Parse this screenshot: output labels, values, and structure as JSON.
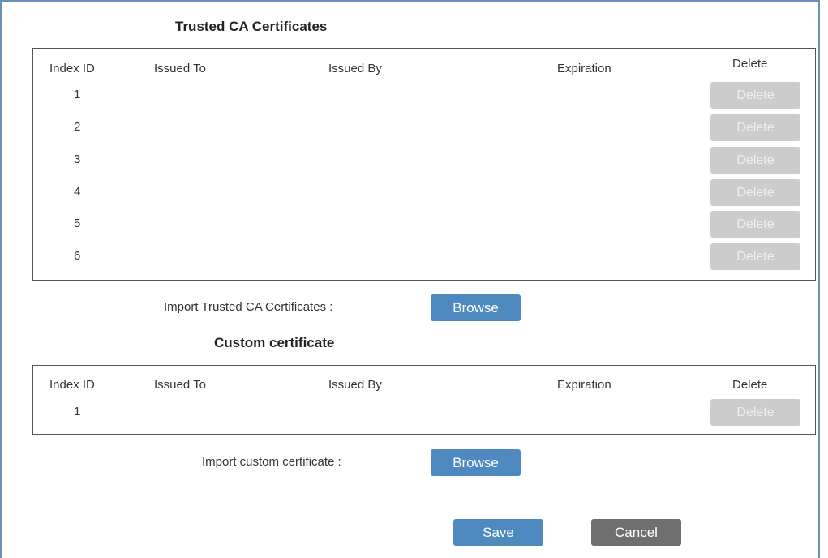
{
  "trusted": {
    "title": "Trusted CA Certificates",
    "headers": {
      "index_id": "Index ID",
      "issued_to": "Issued To",
      "issued_by": "Issued By",
      "expiration": "Expiration",
      "delete": "Delete"
    },
    "rows": [
      {
        "index": "1",
        "delete_label": "Delete"
      },
      {
        "index": "2",
        "delete_label": "Delete"
      },
      {
        "index": "3",
        "delete_label": "Delete"
      },
      {
        "index": "4",
        "delete_label": "Delete"
      },
      {
        "index": "5",
        "delete_label": "Delete"
      },
      {
        "index": "6",
        "delete_label": "Delete"
      }
    ],
    "import_label": "Import Trusted CA Certificates :",
    "browse_label": "Browse"
  },
  "custom": {
    "title": "Custom certificate",
    "headers": {
      "index_id": "Index ID",
      "issued_to": "Issued To",
      "issued_by": "Issued By",
      "expiration": "Expiration",
      "delete": "Delete"
    },
    "rows": [
      {
        "index": "1",
        "delete_label": "Delete"
      }
    ],
    "import_label": "Import custom certificate :",
    "browse_label": "Browse"
  },
  "actions": {
    "save_label": "Save",
    "cancel_label": "Cancel"
  },
  "colors": {
    "primary_button": "#4e8ac0",
    "cancel_button": "#6f6f6f",
    "disabled_button": "#cccccc",
    "frame_border": "#6a8fb8"
  }
}
